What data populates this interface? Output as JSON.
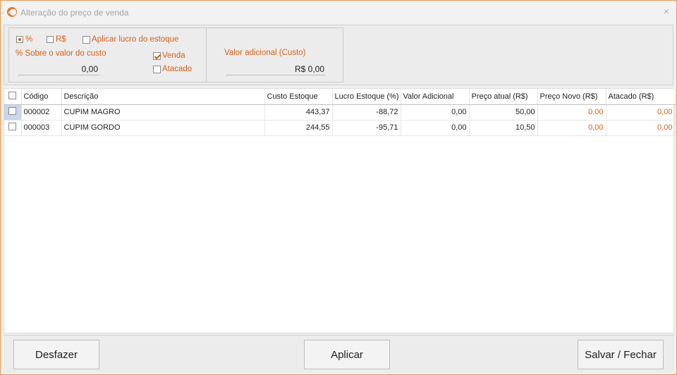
{
  "window": {
    "title": "Alteração do preço de venda",
    "close_glyph": "×"
  },
  "options": {
    "mode_percent": {
      "label": "%",
      "selected": true
    },
    "mode_real": {
      "label": "R$",
      "selected": false
    },
    "apply_stock_profit": {
      "label": "Aplicar lucro do estoque",
      "checked": false
    },
    "percent_label": "% Sobre o valor do custo",
    "percent_value": "0,00",
    "venda": {
      "label": "Venda",
      "checked": true
    },
    "atacado": {
      "label": "Atacado",
      "checked": false
    },
    "additional_label": "Valor adicional (Custo)",
    "additional_value": "R$ 0,00"
  },
  "grid": {
    "columns": [
      "Código",
      "Descrição",
      "Custo Estoque",
      "Lucro Estoque (%)",
      "Valor Adicional",
      "Preço atual (R$)",
      "Preço Novo (R$)",
      "Atacado (R$)"
    ],
    "rows": [
      {
        "codigo": "000002",
        "descricao": "CUPIM MAGRO",
        "custo": "443,37",
        "lucro": "-88,72",
        "adicional": "0,00",
        "preco_atual": "50,00",
        "preco_novo": "0,00",
        "atacado": "0,00"
      },
      {
        "codigo": "000003",
        "descricao": "CUPIM GORDO",
        "custo": "244,55",
        "lucro": "-95,71",
        "adicional": "0,00",
        "preco_atual": "10,50",
        "preco_novo": "0,00",
        "atacado": "0,00"
      }
    ]
  },
  "footer": {
    "undo_label": "Desfazer",
    "apply_label": "Aplicar",
    "save_close_label": "Salvar / Fechar"
  },
  "colors": {
    "accent": "#d4621b",
    "border": "#e59a55"
  }
}
